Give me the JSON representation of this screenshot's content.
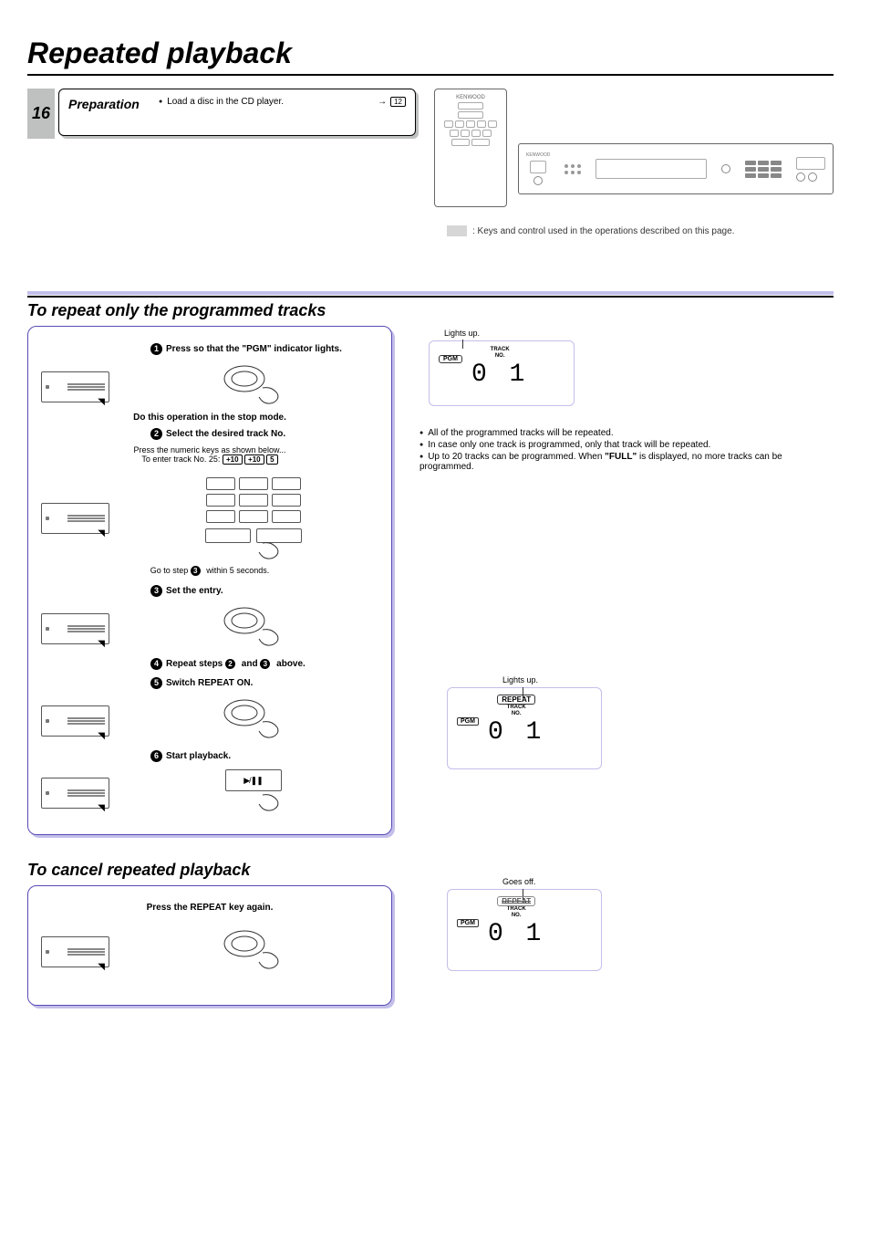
{
  "page_number": "16",
  "title": "Repeated playback",
  "preparation": {
    "label": "Preparation",
    "text": "Load a disc in the CD player.",
    "ref": "12"
  },
  "legend_text": ": Keys and control used in the operations described on this page.",
  "section_a": {
    "heading": "To repeat only the programmed tracks",
    "steps": {
      "s1": "Press so that the \"PGM\" indicator lights.",
      "s1_note": "Do this operation in the stop mode.",
      "s2": "Select the desired track No.",
      "s2_line1": "Press the numeric keys as shown below...",
      "s2_line2a": "To enter track No. 25:",
      "s2_key1": "+10",
      "s2_key2": "+10",
      "s2_key3": "5",
      "s2_note_a": "Go to step ",
      "s2_note_b": " within 5 seconds.",
      "s3": "Set the entry.",
      "s4a": "Repeat steps ",
      "s4b": " and ",
      "s4c": " above.",
      "s5": "Switch REPEAT ON.",
      "s6": "Start playback."
    },
    "display1": {
      "caption": "Lights up.",
      "pgm": "PGM",
      "track_label": "TRACK\nNO.",
      "value": "0 1"
    },
    "info": {
      "l1": "All of the programmed tracks will be repeated.",
      "l2": "In case only one track is programmed, only that track  will be repeated.",
      "l3a": "Up to 20 tracks can be programmed. When ",
      "l3b": "\"FULL\"",
      "l3c": " is displayed, no more tracks can be programmed."
    },
    "display2": {
      "caption": "Lights up.",
      "pgm": "PGM",
      "repeat": "REPEAT",
      "track_label": "TRACK\nNO.",
      "value": "0 1"
    }
  },
  "section_b": {
    "heading": "To cancel repeated playback",
    "step": "Press the REPEAT key again.",
    "display": {
      "caption": "Goes off.",
      "pgm": "PGM",
      "repeat": "REPEAT",
      "track_label": "TRACK\nNO.",
      "value": "0 1"
    }
  }
}
